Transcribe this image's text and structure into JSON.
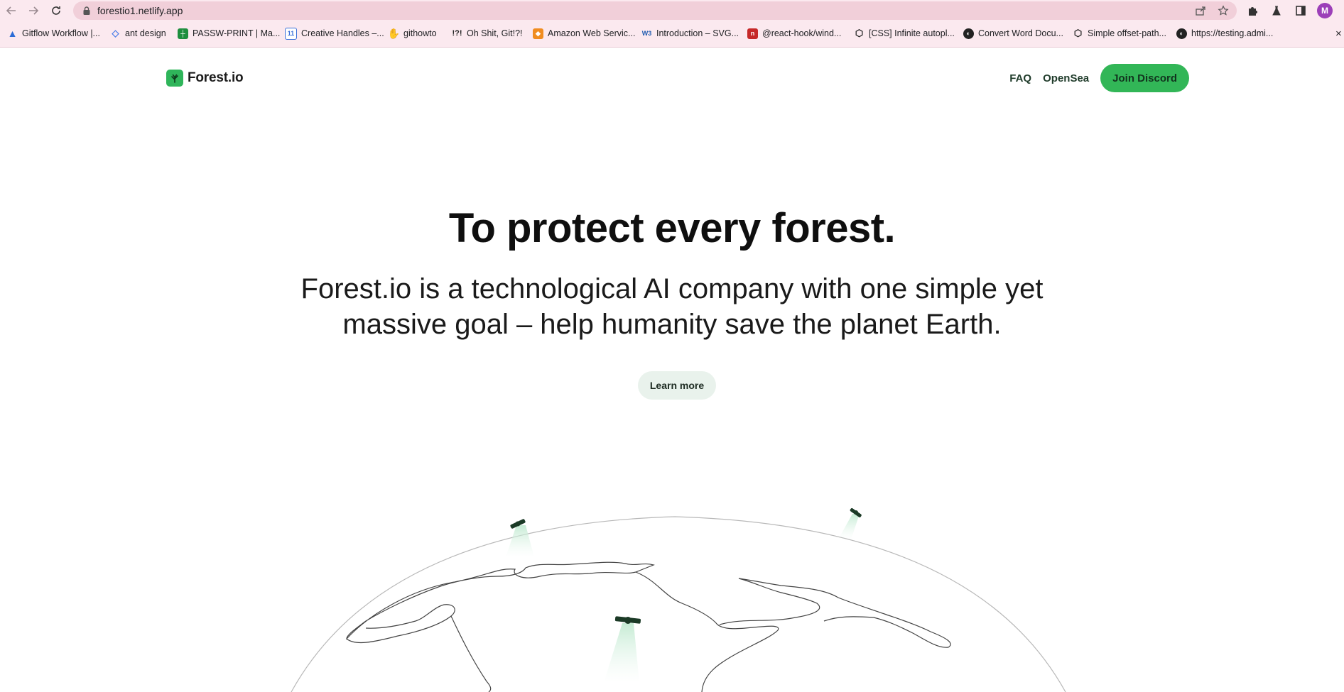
{
  "browser": {
    "url": "forestio1.netlify.app",
    "profile_initial": "M",
    "bookmarks": [
      {
        "label": "Gitflow Workflow |...",
        "icon": "atlassian-icon",
        "color": "#2c6bd6"
      },
      {
        "label": "ant design",
        "icon": "ant-design-icon",
        "color": "#4a7de8"
      },
      {
        "label": "PASSW-PRINT | Ma...",
        "icon": "sheets-icon",
        "color": "#1e8e3e"
      },
      {
        "label": "Creative Handles –...",
        "icon": "calendar-icon",
        "color": "#3a6fd8"
      },
      {
        "label": "githowto",
        "icon": "git-icon",
        "color": "#e2572c"
      },
      {
        "label": "Oh Shit, Git!?!",
        "icon": "exclaim-icon",
        "color": "#222222"
      },
      {
        "label": "Amazon Web Servic...",
        "icon": "aws-icon",
        "color": "#f08c20"
      },
      {
        "label": "Introduction – SVG...",
        "icon": "w3-icon",
        "color": "#1f5bb0"
      },
      {
        "label": "@react-hook/wind...",
        "icon": "npm-icon",
        "color": "#c62828"
      },
      {
        "label": "[CSS] Infinite autopl...",
        "icon": "codepen-icon",
        "color": "#222222"
      },
      {
        "label": "Convert Word Docu...",
        "icon": "globe-icon",
        "color": "#222222"
      },
      {
        "label": "Simple offset-path...",
        "icon": "codepen-icon",
        "color": "#222222"
      },
      {
        "label": "https://testing.admi...",
        "icon": "globe-icon",
        "color": "#222222"
      }
    ]
  },
  "header": {
    "logo_text": "Forest.io",
    "nav": {
      "faq": "FAQ",
      "opensea": "OpenSea",
      "join": "Join Discord"
    }
  },
  "hero": {
    "title": "To protect every forest.",
    "subtitle": "Forest.io is a technological AI company with one simple yet massive goal – help humanity save the planet Earth.",
    "cta": "Learn more"
  },
  "colors": {
    "accent": "#32b657",
    "chrome": "#fbe9ef",
    "cta_bg": "#e9f2ec"
  }
}
